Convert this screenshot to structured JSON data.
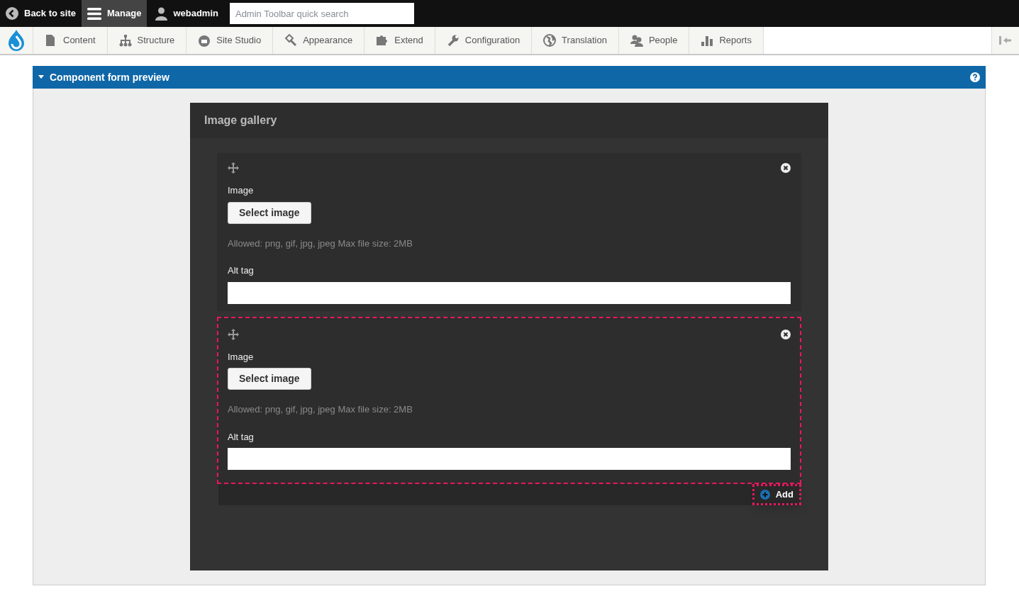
{
  "toolbar": {
    "back": "Back to site",
    "manage": {
      "label": "Manage",
      "selected": true
    },
    "user": "webadmin",
    "search": {
      "placeholder": "Admin Toolbar quick search"
    }
  },
  "menu": [
    {
      "label": "Content"
    },
    {
      "label": "Structure"
    },
    {
      "label": "Site Studio"
    },
    {
      "label": "Appearance"
    },
    {
      "label": "Extend"
    },
    {
      "label": "Configuration"
    },
    {
      "label": "Translation"
    },
    {
      "label": "People"
    },
    {
      "label": "Reports"
    }
  ],
  "panel": {
    "title": "Component form preview",
    "expanded": true,
    "form": {
      "title": "Image gallery",
      "items": [
        {
          "highlighted": false,
          "image_label": "Image",
          "button": "Select image",
          "help": "Allowed: png, gif, jpg, jpeg Max file size: 2MB",
          "alt_label": "Alt tag"
        },
        {
          "highlighted": true,
          "image_label": "Image",
          "button": "Select image",
          "help": "Allowed: png, gif, jpg, jpeg Max file size: 2MB",
          "alt_label": "Alt tag"
        }
      ],
      "add": {
        "label": "Add",
        "highlighted": true
      }
    }
  }
}
